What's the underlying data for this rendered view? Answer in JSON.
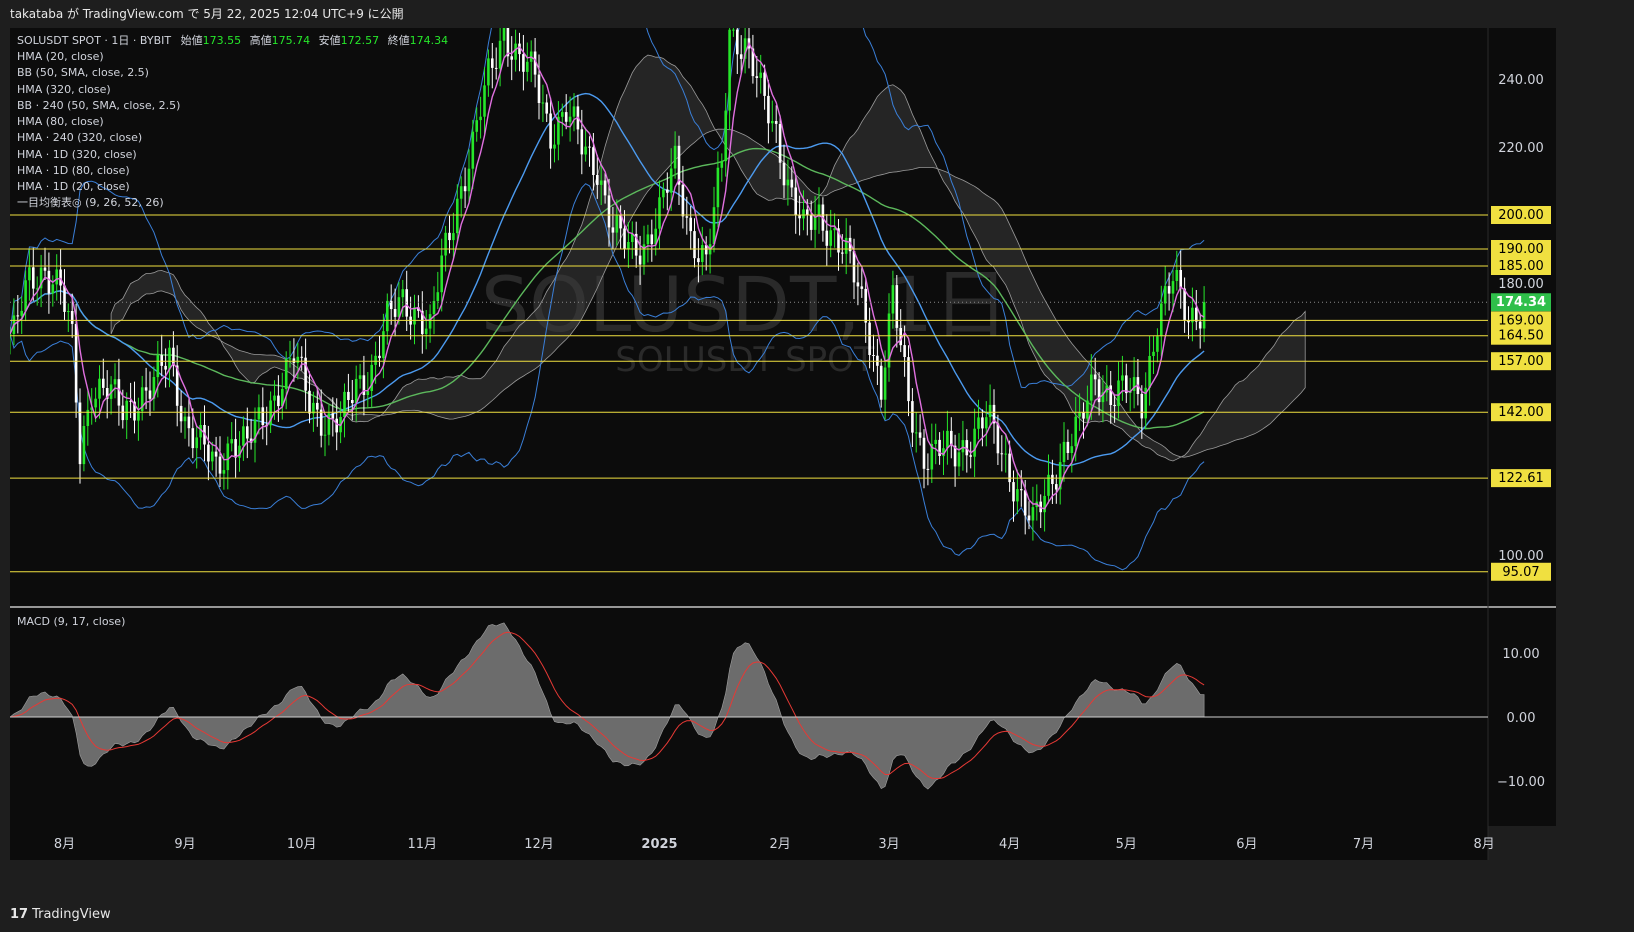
{
  "header": {
    "published_text": "takataba が TradingView.com で 5月 22, 2025 12:04 UTC+9 に公開"
  },
  "legend": {
    "symbol": "SOLUSDT SPOT · 1日 · BYBIT",
    "open_label": "始値",
    "open_value": "173.55",
    "high_label": "高値",
    "high_value": "175.74",
    "low_label": "安値",
    "low_value": "172.57",
    "close_label": "終値",
    "close_value": "174.34",
    "indicators": [
      "HMA (20, close)",
      "BB (50, SMA, close, 2.5)",
      "HMA (320, close)",
      "BB · 240 (50, SMA, close, 2.5)",
      "HMA (80, close)",
      "HMA · 240 (320, close)",
      "HMA · 1D (320, close)",
      "HMA · 1D (80, close)",
      "HMA · 1D (20, close)",
      "一目均衡表◎ (9, 26, 52, 26)"
    ]
  },
  "watermark": {
    "main": "SOLUSDT, 1日",
    "sub": "SOLUSDT SPOT"
  },
  "macd_label": "MACD (9, 17, close)",
  "footer": {
    "logo_icon": "tradingview-logo-icon",
    "brand": "TradingView"
  },
  "colors": {
    "up": "#26e62a",
    "down": "#ffffff",
    "hma_short": "#e070e0",
    "hma_mid": "#4c9bf0",
    "hma_long": "#5cb85c",
    "bb": "#3a7fd8",
    "level": "#f0e040",
    "price_badge": "#2fbf4a"
  },
  "chart_data": [
    {
      "type": "candlestick",
      "ylim": [
        85,
        255
      ],
      "y_ticks": [
        "240.00",
        "220.00",
        "180.00",
        "100.00"
      ],
      "x_ticks": [
        "8月",
        "9月",
        "10月",
        "11月",
        "12月",
        "2025",
        "2月",
        "3月",
        "4月",
        "5月",
        "6月",
        "7月",
        "8月"
      ],
      "x_tick_dates": [
        "2024-08-01",
        "2024-09-01",
        "2024-10-01",
        "2024-11-01",
        "2024-12-01",
        "2025-01-01",
        "2025-02-01",
        "2025-03-01",
        "2025-04-01",
        "2025-05-01",
        "2025-06-01",
        "2025-07-01",
        "2025-08-01"
      ],
      "last_price": 174.34,
      "last_price_label": "174.34",
      "horizontal_levels": [
        {
          "value": 200.0,
          "label": "200.00"
        },
        {
          "value": 190.0,
          "label": "190.00"
        },
        {
          "value": 185.0,
          "label": "185.00"
        },
        {
          "value": 169.0,
          "label": "169.00"
        },
        {
          "value": 164.5,
          "label": "164.50"
        },
        {
          "value": 157.0,
          "label": "157.00"
        },
        {
          "value": 142.0,
          "label": "142.00"
        },
        {
          "value": 122.61,
          "label": "122.61"
        },
        {
          "value": 95.07,
          "label": "95.07"
        }
      ],
      "close_path": [
        [
          "2024-07-19",
          165
        ],
        [
          "2024-07-23",
          180
        ],
        [
          "2024-07-27",
          185
        ],
        [
          "2024-07-31",
          178
        ],
        [
          "2024-08-03",
          162
        ],
        [
          "2024-08-05",
          130
        ],
        [
          "2024-08-08",
          150
        ],
        [
          "2024-08-12",
          148
        ],
        [
          "2024-08-16",
          142
        ],
        [
          "2024-08-20",
          147
        ],
        [
          "2024-08-24",
          150
        ],
        [
          "2024-08-28",
          158
        ],
        [
          "2024-09-01",
          140
        ],
        [
          "2024-09-05",
          132
        ],
        [
          "2024-09-09",
          125
        ],
        [
          "2024-09-13",
          135
        ],
        [
          "2024-09-17",
          132
        ],
        [
          "2024-09-21",
          140
        ],
        [
          "2024-09-25",
          150
        ],
        [
          "2024-09-29",
          158
        ],
        [
          "2024-10-03",
          145
        ],
        [
          "2024-10-07",
          140
        ],
        [
          "2024-10-11",
          138
        ],
        [
          "2024-10-15",
          150
        ],
        [
          "2024-10-19",
          155
        ],
        [
          "2024-10-23",
          168
        ],
        [
          "2024-10-27",
          175
        ],
        [
          "2024-10-31",
          172
        ],
        [
          "2024-11-03",
          165
        ],
        [
          "2024-11-06",
          185
        ],
        [
          "2024-11-10",
          205
        ],
        [
          "2024-11-14",
          220
        ],
        [
          "2024-11-18",
          240
        ],
        [
          "2024-11-22",
          255
        ],
        [
          "2024-11-26",
          245
        ],
        [
          "2024-11-30",
          240
        ],
        [
          "2024-12-04",
          225
        ],
        [
          "2024-12-08",
          230
        ],
        [
          "2024-12-12",
          220
        ],
        [
          "2024-12-16",
          215
        ],
        [
          "2024-12-20",
          195
        ],
        [
          "2024-12-24",
          190
        ],
        [
          "2024-12-28",
          192
        ],
        [
          "2025-01-01",
          200
        ],
        [
          "2025-01-05",
          215
        ],
        [
          "2025-01-09",
          195
        ],
        [
          "2025-01-13",
          185
        ],
        [
          "2025-01-17",
          215
        ],
        [
          "2025-01-19",
          255
        ],
        [
          "2025-01-23",
          250
        ],
        [
          "2025-01-27",
          235
        ],
        [
          "2025-01-31",
          225
        ],
        [
          "2025-02-03",
          210
        ],
        [
          "2025-02-07",
          195
        ],
        [
          "2025-02-11",
          200
        ],
        [
          "2025-02-15",
          195
        ],
        [
          "2025-02-19",
          185
        ],
        [
          "2025-02-23",
          170
        ],
        [
          "2025-02-27",
          150
        ],
        [
          "2025-03-02",
          175
        ],
        [
          "2025-03-06",
          145
        ],
        [
          "2025-03-10",
          130
        ],
        [
          "2025-03-14",
          130
        ],
        [
          "2025-03-18",
          130
        ],
        [
          "2025-03-22",
          135
        ],
        [
          "2025-03-26",
          140
        ],
        [
          "2025-03-30",
          130
        ],
        [
          "2025-04-03",
          120
        ],
        [
          "2025-04-07",
          108
        ],
        [
          "2025-04-11",
          120
        ],
        [
          "2025-04-15",
          132
        ],
        [
          "2025-04-19",
          137
        ],
        [
          "2025-04-23",
          152
        ],
        [
          "2025-04-27",
          148
        ],
        [
          "2025-05-01",
          148
        ],
        [
          "2025-05-05",
          145
        ],
        [
          "2025-05-09",
          170
        ],
        [
          "2025-05-13",
          180
        ],
        [
          "2025-05-17",
          170
        ],
        [
          "2025-05-21",
          174.34
        ]
      ]
    },
    {
      "type": "area",
      "name_label": "MACD (9, 17, close)",
      "ylim": [
        -17,
        17
      ],
      "y_ticks": [
        "10.00",
        "0.00",
        "−10.00"
      ],
      "y_tick_values": [
        10,
        0,
        -10
      ]
    }
  ]
}
